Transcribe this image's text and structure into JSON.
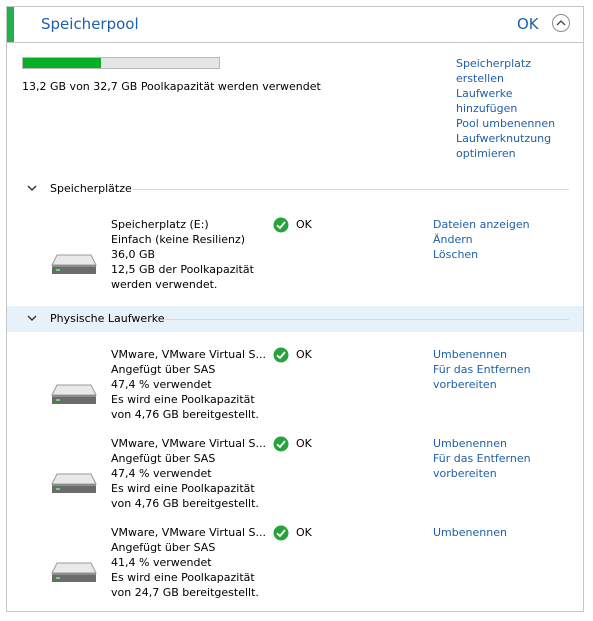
{
  "header": {
    "title": "Speicherpool",
    "status": "OK"
  },
  "pool": {
    "usage_fraction": 0.4,
    "capacity_text": "13,2 GB von 32,7 GB Poolkapazität werden verwendet",
    "actions": [
      "Speicherplatz",
      "erstellen",
      "Laufwerke",
      "hinzufügen",
      "Pool umbenennen",
      "Laufwerknutzung",
      "optimieren"
    ]
  },
  "spaces_section": {
    "title": "Speicherplätze",
    "items": [
      {
        "lines": [
          "Speicherplatz (E:)",
          "Einfach (keine Resilienz)",
          "36,0 GB",
          "12,5 GB der Poolkapazität",
          "werden verwendet."
        ],
        "status": "OK",
        "actions": [
          "Dateien anzeigen",
          "Ändern",
          "Löschen"
        ]
      }
    ]
  },
  "drives_section": {
    "title": "Physische Laufwerke",
    "items": [
      {
        "lines": [
          "VMware, VMware Virtual S...",
          "Angefügt über SAS",
          "47,4 % verwendet",
          "Es wird eine Poolkapazität",
          "von 4,76 GB bereitgestellt."
        ],
        "status": "OK",
        "actions": [
          "Umbenennen",
          "Für das Entfernen",
          "vorbereiten"
        ]
      },
      {
        "lines": [
          "VMware, VMware Virtual S...",
          "Angefügt über SAS",
          "47,4 % verwendet",
          "Es wird eine Poolkapazität",
          "von 4,76 GB bereitgestellt."
        ],
        "status": "OK",
        "actions": [
          "Umbenennen",
          "Für das Entfernen",
          "vorbereiten"
        ]
      },
      {
        "lines": [
          "VMware, VMware Virtual S...",
          "Angefügt über SAS",
          "41,4 % verwendet",
          "Es wird eine Poolkapazität",
          "von 24,7 GB bereitgestellt."
        ],
        "status": "OK",
        "actions": [
          "Umbenennen"
        ]
      }
    ]
  },
  "colors": {
    "accent": "#22b14c",
    "link": "#1f5fa8",
    "progress_fill": "#06b025",
    "ok_check": "#27a33a"
  },
  "icons": {
    "collapse": "chevron-up-icon",
    "section_toggle": "chevron-down-icon",
    "status": "check-circle-icon",
    "drive": "hard-drive-icon"
  }
}
